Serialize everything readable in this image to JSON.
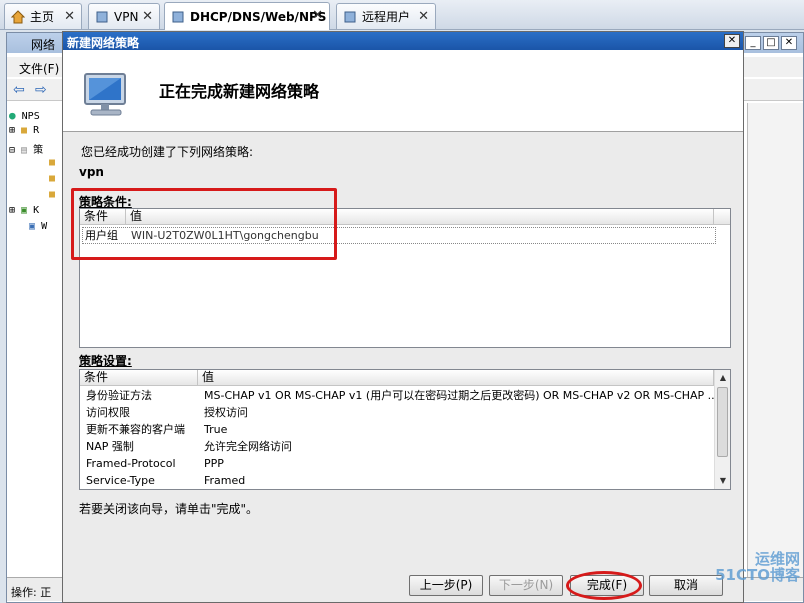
{
  "tabs": [
    {
      "label": "主页",
      "active": false
    },
    {
      "label": "VPN",
      "active": false
    },
    {
      "label": "DHCP/DNS/Web/NPS",
      "active": true
    },
    {
      "label": "远程用户",
      "active": false
    }
  ],
  "background_window": {
    "title": "网络",
    "menu_file": "文件(F)",
    "tree": [
      "NPS",
      "R",
      "策",
      "",
      "",
      "",
      "K",
      "W"
    ],
    "status": "操作:  正"
  },
  "dialog": {
    "title": "新建网络策略",
    "heading": "正在完成新建网络策略",
    "intro": "您已经成功创建了下列网络策略:",
    "policy_name": "vpn",
    "conditions_label": "策略条件:",
    "conditions_columns": [
      "条件",
      "值"
    ],
    "conditions_rows": [
      {
        "condition": "用户组",
        "value": "WIN-U2T0ZW0L1HT\\gongchengbu"
      }
    ],
    "settings_label": "策略设置:",
    "settings_columns": [
      "条件",
      "值"
    ],
    "settings_rows": [
      {
        "condition": "身份验证方法",
        "value": "MS-CHAP v1 OR MS-CHAP v1 (用户可以在密码过期之后更改密码) OR MS-CHAP v2 OR MS-CHAP ..."
      },
      {
        "condition": "访问权限",
        "value": "授权访问"
      },
      {
        "condition": "更新不兼容的客户端",
        "value": "True"
      },
      {
        "condition": "NAP 强制",
        "value": "允许完全网络访问"
      },
      {
        "condition": "Framed-Protocol",
        "value": "PPP"
      },
      {
        "condition": "Service-Type",
        "value": "Framed"
      }
    ],
    "close_hint": "若要关闭该向导，请单击\"完成\"。",
    "buttons": {
      "back": "上一步(P)",
      "next": "下一步(N)",
      "finish": "完成(F)",
      "cancel": "取消"
    }
  },
  "watermark": {
    "line1": "运维网",
    "line2": "51CTO博客"
  },
  "colors": {
    "highlight": "#d61a1a",
    "title_bar": "#1b55a8"
  }
}
